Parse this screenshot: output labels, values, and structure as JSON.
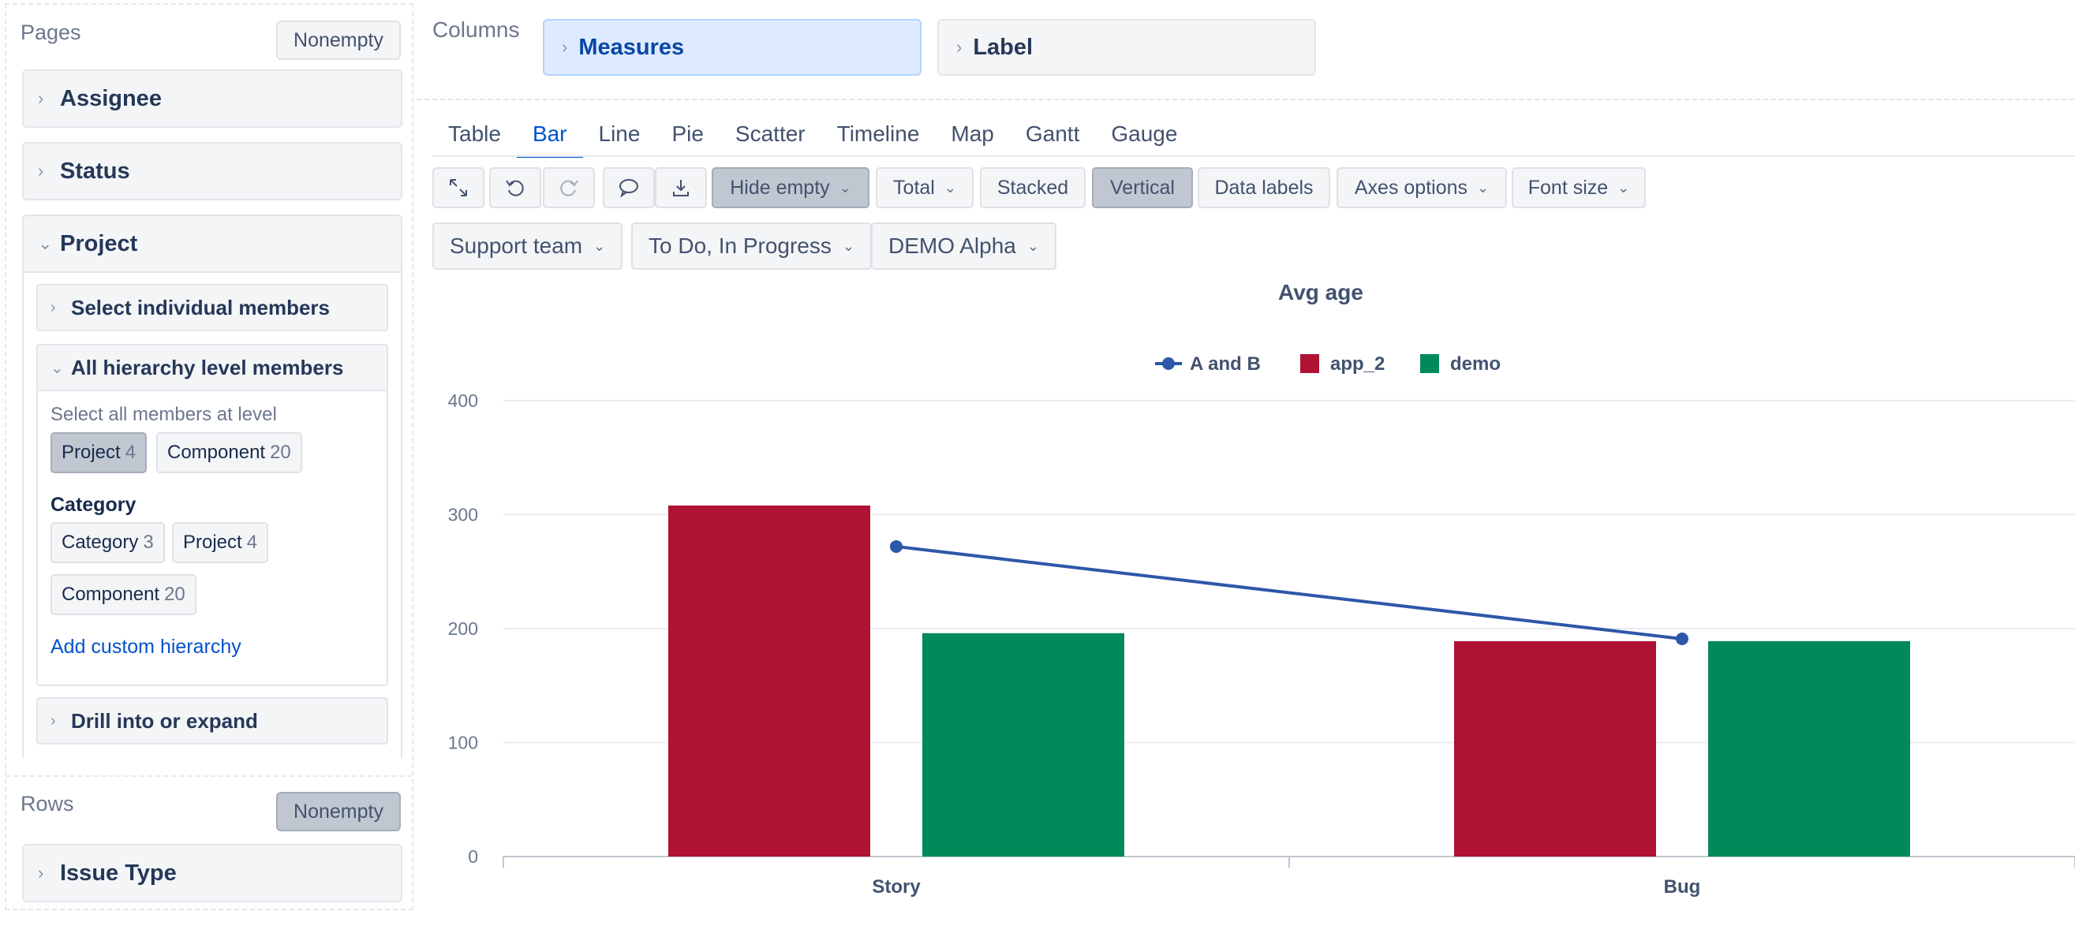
{
  "pages": {
    "title": "Pages",
    "nonempty_label": "Nonempty",
    "items": [
      {
        "label": "Assignee"
      },
      {
        "label": "Status"
      },
      {
        "label": "Project"
      }
    ],
    "project": {
      "select_individual_label": "Select individual members",
      "all_hierarchy_label": "All hierarchy level members",
      "select_all_text": "Select all members at level",
      "level_chips": [
        {
          "label": "Project",
          "count": "4"
        },
        {
          "label": "Component",
          "count": "20"
        }
      ],
      "category_title": "Category",
      "category_chips": [
        {
          "label": "Category",
          "count": "3"
        },
        {
          "label": "Project",
          "count": "4"
        },
        {
          "label": "Component",
          "count": "20"
        }
      ],
      "add_custom_label": "Add custom hierarchy",
      "drill_label": "Drill into or expand"
    }
  },
  "rows": {
    "title": "Rows",
    "nonempty_label": "Nonempty",
    "items": [
      {
        "label": "Issue Type"
      }
    ]
  },
  "columns": {
    "title": "Columns",
    "items": [
      {
        "label": "Measures"
      },
      {
        "label": "Label"
      }
    ]
  },
  "tabs": [
    "Table",
    "Bar",
    "Line",
    "Pie",
    "Scatter",
    "Timeline",
    "Map",
    "Gantt",
    "Gauge"
  ],
  "active_tab": "Bar",
  "toolbar": {
    "hide_empty": "Hide empty",
    "total": "Total",
    "stacked": "Stacked",
    "vertical": "Vertical",
    "data_labels": "Data labels",
    "axes_options": "Axes options",
    "font_size": "Font size"
  },
  "filters": [
    "Support team",
    "To Do, In Progress",
    "DEMO Alpha"
  ],
  "chart_data": {
    "type": "bar",
    "title": "Avg age",
    "categories": [
      "Story",
      "Bug"
    ],
    "series": [
      {
        "name": "A and B",
        "type": "line",
        "color": "#2d57a8",
        "values": [
          272,
          191
        ]
      },
      {
        "name": "app_2",
        "type": "bar",
        "color": "#b01233",
        "values": [
          308,
          189
        ]
      },
      {
        "name": "demo",
        "type": "bar",
        "color": "#008a59",
        "values": [
          196,
          189
        ]
      }
    ],
    "ylim": [
      0,
      400
    ],
    "yticks": [
      0,
      100,
      200,
      300,
      400
    ],
    "legend": "top-center",
    "grid": true
  }
}
